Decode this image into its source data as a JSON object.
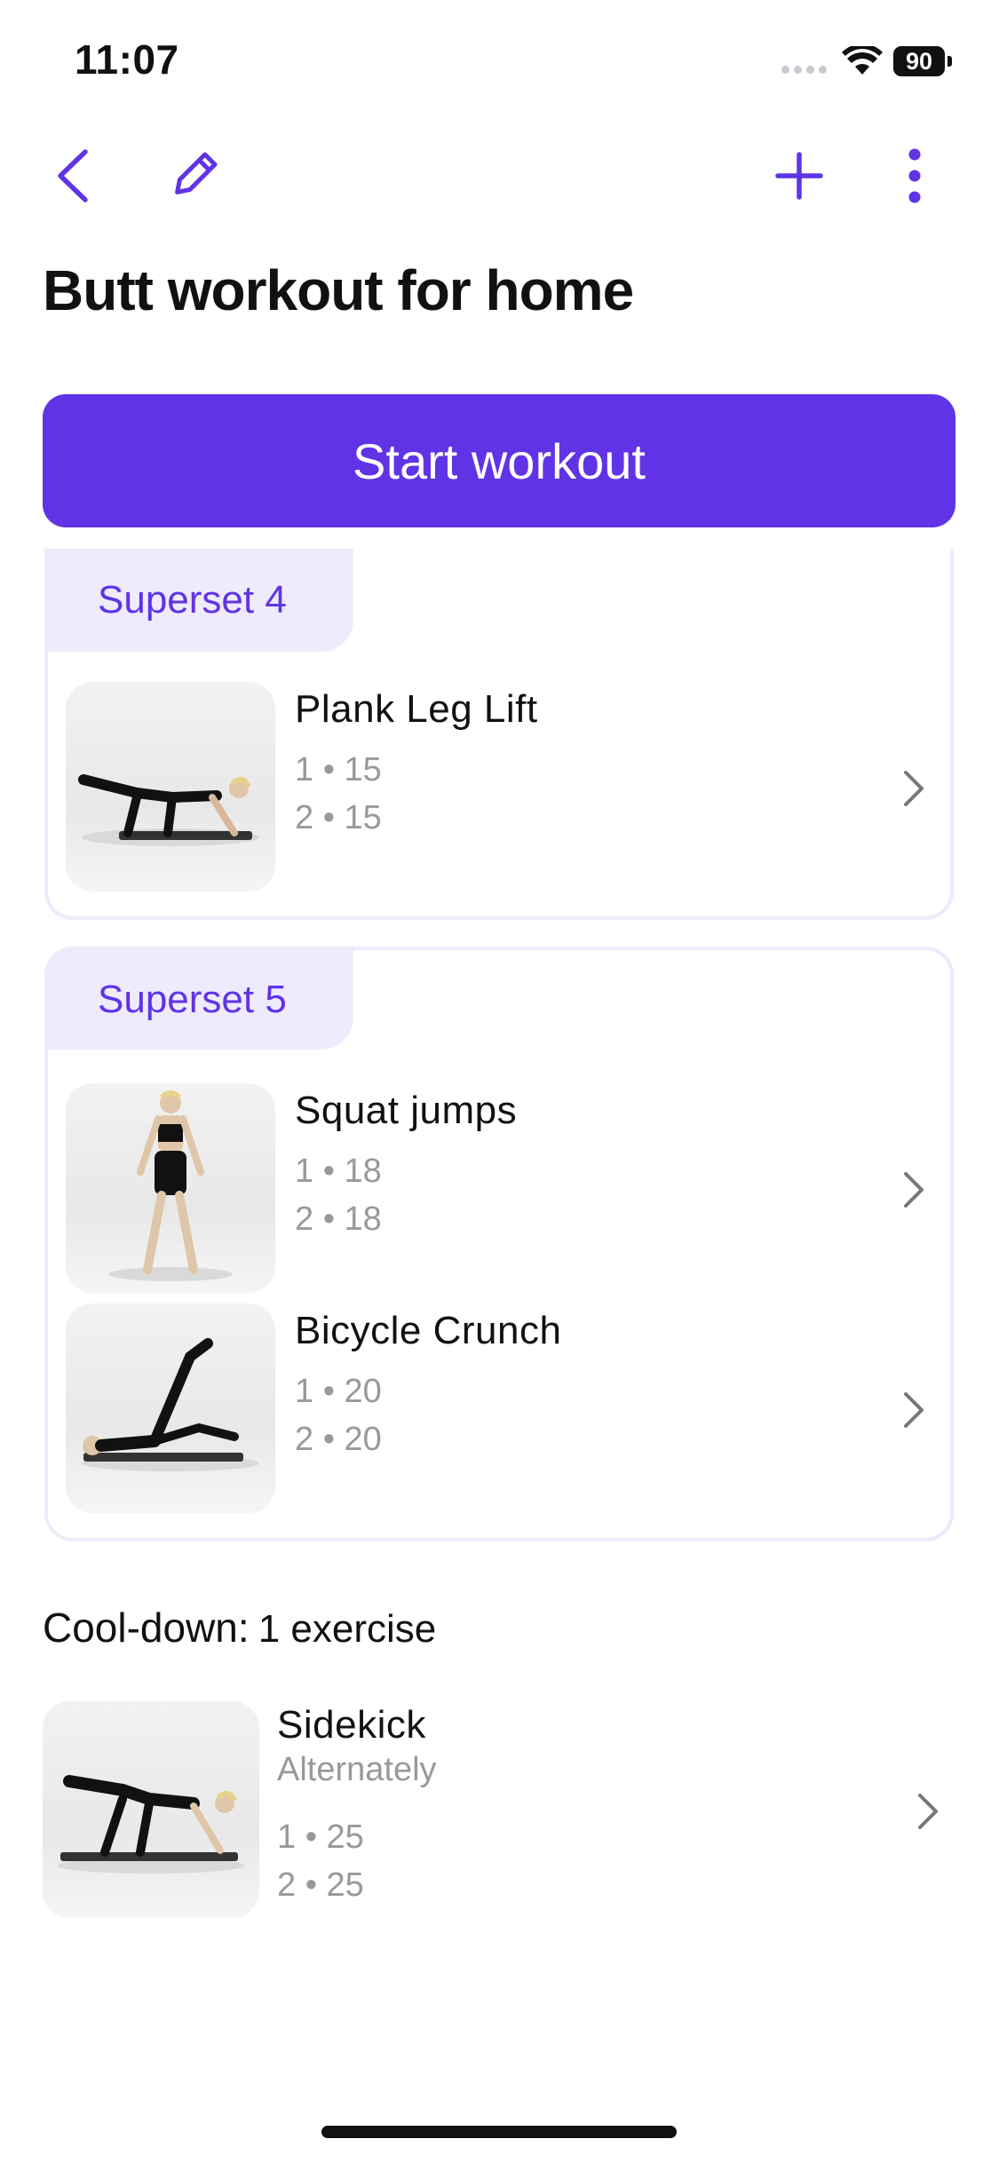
{
  "status_bar": {
    "time": "11:07",
    "battery": "90"
  },
  "nav": {
    "back_icon": "chevron-left",
    "edit_icon": "pencil",
    "add_icon": "plus",
    "more_icon": "vertical-ellipsis"
  },
  "title": "Butt workout for home",
  "start_button": "Start workout",
  "supersets": [
    {
      "label": "Superset 4",
      "exercises": [
        {
          "name": "Plank Leg Lift",
          "sets": [
            "1 • 15",
            "2 • 15"
          ]
        }
      ]
    },
    {
      "label": "Superset 5",
      "exercises": [
        {
          "name": "Squat jumps",
          "sets": [
            "1 • 18",
            "2 • 18"
          ]
        },
        {
          "name": "Bicycle Crunch",
          "sets": [
            "1 • 20",
            "2 • 20"
          ]
        }
      ]
    }
  ],
  "cooldown": {
    "label": "Cool-down:",
    "count": "1 exercise",
    "exercises": [
      {
        "name": "Sidekick",
        "subtitle": "Alternately",
        "sets": [
          "1 • 25",
          "2 • 25"
        ]
      }
    ]
  },
  "colors": {
    "accent": "#6033E6",
    "tag_bg": "#EEEBFC",
    "muted": "#999999"
  }
}
